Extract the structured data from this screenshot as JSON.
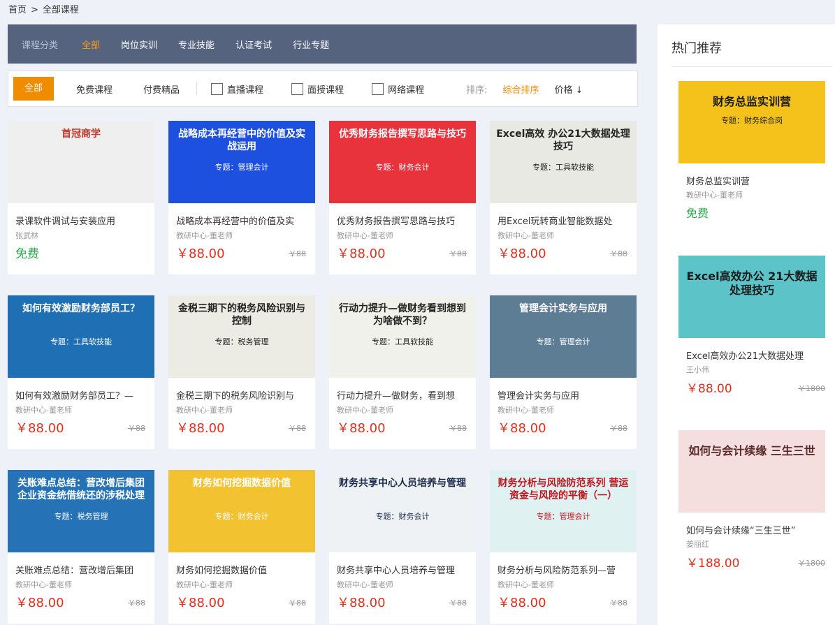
{
  "breadcrumb": {
    "home": "首页",
    "sep": ">",
    "current": "全部课程"
  },
  "category": {
    "label": "课程分类",
    "items": [
      "全部",
      "岗位实训",
      "专业技能",
      "认证考试",
      "行业专题"
    ]
  },
  "filter": {
    "all": "全部",
    "free": "免费课程",
    "paid": "付费精品",
    "checks": [
      "直播课程",
      "面授课程",
      "网络课程"
    ],
    "sort_label": "排序:",
    "sort_default": "综合排序",
    "sort_price": "价格 ↓"
  },
  "colors": {
    "accent": "#f08c00",
    "price": "#e2301e",
    "free": "#2aa84a",
    "catbar": "#56637f"
  },
  "courses": [
    {
      "thumb_l1": "首冠商学",
      "thumb_l2": "",
      "title": "录课软件调试与安装应用",
      "teacher": "张武林",
      "price": "免费",
      "orig": "",
      "bg": "#efefef",
      "fg": "#c0392b"
    },
    {
      "thumb_l1": "战略成本再经营中的价值及实战运用",
      "thumb_l2": "专题：管理会计",
      "title": "战略成本再经营中的价值及实",
      "teacher": "教研中心-董老师",
      "price": "￥88.00",
      "orig": "￥88",
      "bg": "#1e50e0",
      "fg": "#ffffff"
    },
    {
      "thumb_l1": "优秀财务报告撰写思路与技巧",
      "thumb_l2": "专题：财务会计",
      "title": "优秀财务报告撰写思路与技巧",
      "teacher": "教研中心-董老师",
      "price": "￥88.00",
      "orig": "￥88",
      "bg": "#e8323c",
      "fg": "#ffffff"
    },
    {
      "thumb_l1": "Excel高效 办公21大数据处理技巧",
      "thumb_l2": "专题：工具软技能",
      "title": "用Excel玩转商业智能数据处",
      "teacher": "教研中心-董老师",
      "price": "￥88.00",
      "orig": "￥88",
      "bg": "#e9e9e4",
      "fg": "#222222"
    },
    {
      "thumb_l1": "如何有效激励财务部员工？",
      "thumb_l2": "专题：工具软技能",
      "title": "如何有效激励财务部员工？—",
      "teacher": "教研中心-董老师",
      "price": "￥88.00",
      "orig": "￥88",
      "bg": "#1f6fb5",
      "fg": "#ffffff"
    },
    {
      "thumb_l1": "金税三期下的税务风险识别与控制",
      "thumb_l2": "专题：税务管理",
      "title": "金税三期下的税务风险识别与",
      "teacher": "教研中心-董老师",
      "price": "￥88.00",
      "orig": "￥88",
      "bg": "#ecebe4",
      "fg": "#222222"
    },
    {
      "thumb_l1": "行动力提升—做财务看到想到为啥做不到？",
      "thumb_l2": "专题：工具软技能",
      "title": "行动力提升—做财务，看到想",
      "teacher": "教研中心-董老师",
      "price": "￥88.00",
      "orig": "￥88",
      "bg": "#f1f1ec",
      "fg": "#222222"
    },
    {
      "thumb_l1": "管理会计实务与应用",
      "thumb_l2": "专题：管理会计",
      "title": "管理会计实务与应用",
      "teacher": "教研中心-董老师",
      "price": "￥88.00",
      "orig": "￥88",
      "bg": "#5d7d95",
      "fg": "#ffffff"
    },
    {
      "thumb_l1": "关账难点总结：营改增后集团企业资金统借统还的涉税处理",
      "thumb_l2": "专题：税务管理",
      "title": "关账难点总结：营改增后集团",
      "teacher": "教研中心-董老师",
      "price": "￥88.00",
      "orig": "￥88",
      "bg": "#2572b6",
      "fg": "#ffffff"
    },
    {
      "thumb_l1": "财务如何挖掘数据价值",
      "thumb_l2": "专题：财务会计",
      "title": "财务如何挖掘数据价值",
      "teacher": "教研中心-董老师",
      "price": "￥88.00",
      "orig": "￥88",
      "bg": "#f2c230",
      "fg": "#ffffff"
    },
    {
      "thumb_l1": "财务共享中心人员培养与管理",
      "thumb_l2": "专题：财务会计",
      "title": "财务共享中心人员培养与管理",
      "teacher": "教研中心-董老师",
      "price": "￥88.00",
      "orig": "￥88",
      "bg": "#eef2f5",
      "fg": "#1b2a4a"
    },
    {
      "thumb_l1": "财务分析与风险防范系列 营运资金与风险的平衡（一）",
      "thumb_l2": "专题：管理会计",
      "title": "财务分析与风险防范系列—营",
      "teacher": "教研中心-董老师",
      "price": "￥88.00",
      "orig": "￥88",
      "bg": "#dff1f1",
      "fg": "#c0141e"
    }
  ],
  "sidebar": {
    "title": "热门推荐",
    "items": [
      {
        "thumb_l1": "财务总监实训营",
        "thumb_l2": "专题：财务综合岗",
        "title": "财务总监实训营",
        "teacher": "教研中心-董老师",
        "price": "免费",
        "orig": "",
        "bg": "#f4c21a",
        "fg": "#1b1b1b"
      },
      {
        "thumb_l1": "Excel高效办公 21大数据处理技巧",
        "thumb_l2": "",
        "title": "Excel高效办公21大数据处理",
        "teacher": "王小伟",
        "price": "￥88.00",
        "orig": "￥1800",
        "bg": "#5cc3c9",
        "fg": "#1b1b1b"
      },
      {
        "thumb_l1": "如何与会计续缘 三生三世",
        "thumb_l2": "",
        "title": "如何与会计续缘“三生三世”",
        "teacher": "姜丽红",
        "price": "￥188.00",
        "orig": "￥1800",
        "bg": "#f4dede",
        "fg": "#5a2a2a"
      }
    ]
  }
}
